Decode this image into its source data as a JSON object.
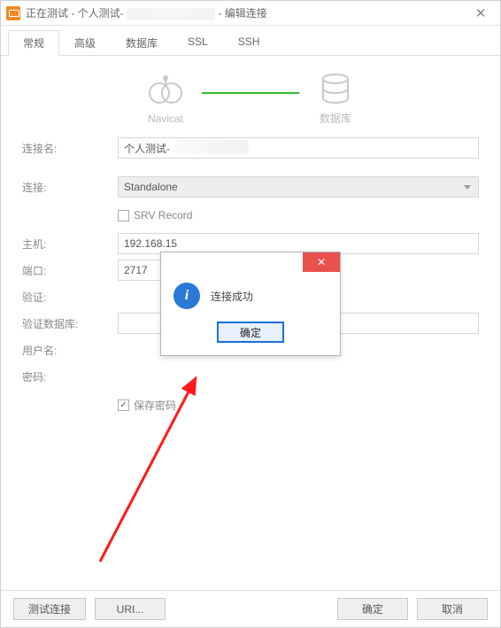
{
  "title": {
    "prefix": "正在测试 - 个人测试-",
    "suffix": " - 编辑连接"
  },
  "tabs": [
    "常规",
    "高级",
    "数据库",
    "SSL",
    "SSH"
  ],
  "header": {
    "left": "Navicat",
    "right": "数据库"
  },
  "form": {
    "connName_label": "连接名:",
    "connName_value": "个人测试-",
    "conn_label": "连接:",
    "conn_value": "Standalone",
    "srv_label": "SRV Record",
    "host_label": "主机:",
    "host_value": "192.168.15",
    "port_label": "端口:",
    "port_value": "2717",
    "auth_label": "验证:",
    "authdb_label": "验证数据库:",
    "user_label": "用户名:",
    "pass_label": "密码:",
    "savepass_label": "保存密码"
  },
  "footer": {
    "test": "测试连接",
    "uri": "URI...",
    "ok": "确定",
    "cancel": "取消"
  },
  "dialog": {
    "message": "连接成功",
    "ok": "确定"
  }
}
